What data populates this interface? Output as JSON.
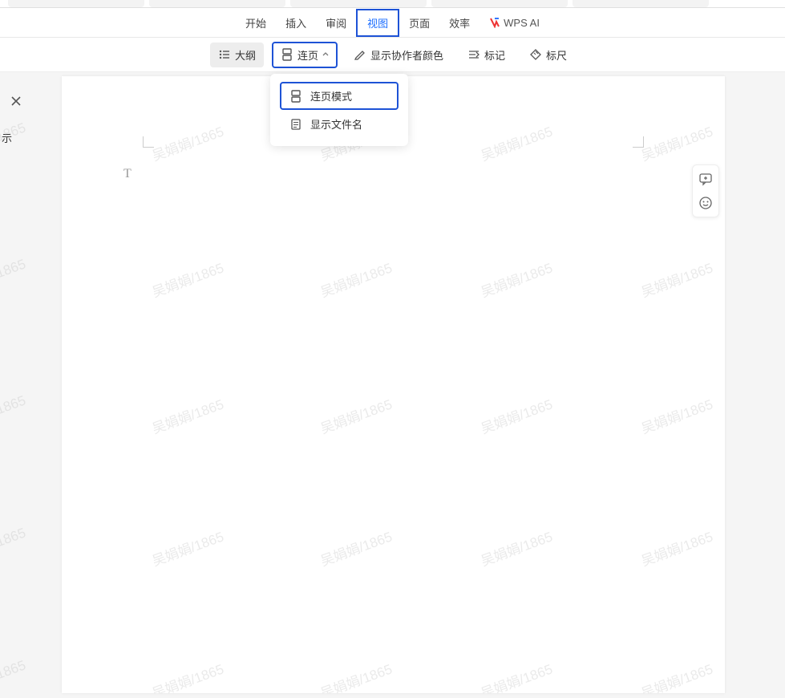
{
  "menu": {
    "items": [
      {
        "label": "开始"
      },
      {
        "label": "插入"
      },
      {
        "label": "审阅"
      },
      {
        "label": "视图",
        "active": true
      },
      {
        "label": "页面"
      },
      {
        "label": "效率"
      }
    ],
    "wps_ai_label": "WPS AI"
  },
  "toolbar": {
    "outline_label": "大纲",
    "continuous_label": "连页",
    "show_author_colors_label": "显示协作者颜色",
    "marks_label": "标记",
    "ruler_label": "标尺"
  },
  "dropdown": {
    "continuous_mode_label": "连页模式",
    "show_filename_label": "显示文件名"
  },
  "sidebar": {
    "close_icon": "close",
    "partial_label": "示"
  },
  "watermark_text": "吴娟娟/1865",
  "right_tools": {
    "comment_icon": "comment-add",
    "emoji_icon": "emoji"
  },
  "cursor_glyph": "T"
}
